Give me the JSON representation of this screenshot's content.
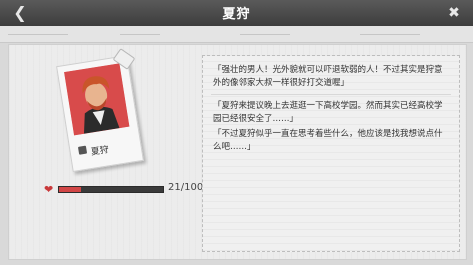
{
  "header": {
    "title": "夏狩",
    "back_icon": "back-arrow-icon",
    "close_icon": "close-icon"
  },
  "card": {
    "name": "夏狩",
    "photo_bg": "#d84b4b",
    "hair_color": "#c9552a"
  },
  "favor": {
    "text": "21/100",
    "fraction": 0.21,
    "fill_color": "#d24646"
  },
  "dialog": {
    "line1": "「强壮的男人！光外貌就可以吓退软弱的人！不过其实是狩意外的像邻家大叔一样很好打交道喔」",
    "line2": "「夏狩来提议晚上去逛逛一下高校学园。然而其实已经高校学园已经很安全了……」",
    "line3": "「不过夏狩似乎一直在思考着些什么，他应该是找我想说点什么吧……」"
  },
  "colors": {
    "accent": "#d24646",
    "topbar": "#4a4a4a"
  }
}
